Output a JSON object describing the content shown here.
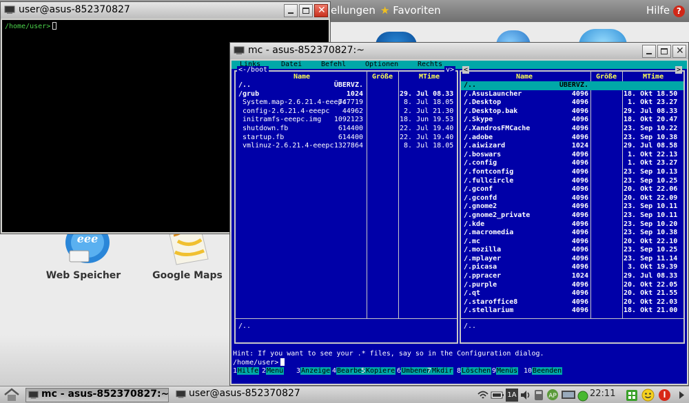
{
  "desktop": {
    "topbar": {
      "left_partial": "ellungen",
      "favorites": "Favoriten",
      "help": "Hilfe"
    },
    "launchers": [
      {
        "label": "Web Speicher"
      },
      {
        "label": "Google Maps"
      }
    ]
  },
  "terminal": {
    "title": "user@asus-852370827",
    "prompt": "/home/user>"
  },
  "mc": {
    "title": "mc - asus-852370827:~",
    "menubar": [
      "Links",
      "Datei",
      "Befehl",
      "Optionen",
      "Rechts"
    ],
    "left_panel": {
      "path": "<-/boot",
      "arrow": "v>",
      "headers": {
        "name": "Name",
        "size": "Größe",
        "mtime": "MTime"
      },
      "rows": [
        {
          "name": "/..",
          "size": "ÜBERVZ.",
          "mtime": "",
          "bold": true
        },
        {
          "name": "/grub",
          "size": "1024",
          "mtime": "29. Jul 08.33",
          "bold": true
        },
        {
          "name": " System.map-2.6.21.4-eeepc",
          "size": "747719",
          "mtime": " 8. Jul 18.05",
          "bold": false
        },
        {
          "name": " config-2.6.21.4-eeepc",
          "size": "44962",
          "mtime": " 2. Jul 21.30",
          "bold": false
        },
        {
          "name": " initramfs-eeepc.img",
          "size": "1092123",
          "mtime": "18. Jun 19.53",
          "bold": false
        },
        {
          "name": " shutdown.fb",
          "size": "614400",
          "mtime": "22. Jul 19.40",
          "bold": false
        },
        {
          "name": " startup.fb",
          "size": "614400",
          "mtime": "22. Jul 19.40",
          "bold": false
        },
        {
          "name": " vmlinuz-2.6.21.4-eeepc",
          "size": "1327864",
          "mtime": " 8. Jul 18.05",
          "bold": false
        }
      ],
      "status": "/.."
    },
    "right_panel": {
      "nav_left": "<",
      "nav_right": ">",
      "headers": {
        "name": "Name",
        "size": "Größe",
        "mtime": "MTime"
      },
      "rows": [
        {
          "name": "/..",
          "size": "ÜBERVZ.",
          "mtime": "",
          "selected": true
        },
        {
          "name": "/.AsusLauncher",
          "size": "4096",
          "mtime": "18. Okt 18.50"
        },
        {
          "name": "/.Desktop",
          "size": "4096",
          "mtime": " 1. Okt 23.27"
        },
        {
          "name": "/.Desktop.bak",
          "size": "4096",
          "mtime": "29. Jul 08.33"
        },
        {
          "name": "/.Skype",
          "size": "4096",
          "mtime": "18. Okt 20.47"
        },
        {
          "name": "/.XandrosFMCache",
          "size": "4096",
          "mtime": "23. Sep 10.22"
        },
        {
          "name": "/.adobe",
          "size": "4096",
          "mtime": "23. Sep 10.38"
        },
        {
          "name": "/.aiwizard",
          "size": "1024",
          "mtime": "29. Jul 08.58"
        },
        {
          "name": "/.boswars",
          "size": "4096",
          "mtime": " 1. Okt 22.13"
        },
        {
          "name": "/.config",
          "size": "4096",
          "mtime": " 1. Okt 23.27"
        },
        {
          "name": "/.fontconfig",
          "size": "4096",
          "mtime": "23. Sep 10.13"
        },
        {
          "name": "/.fullcircle",
          "size": "4096",
          "mtime": "23. Sep 10.25"
        },
        {
          "name": "/.gconf",
          "size": "4096",
          "mtime": "20. Okt 22.06"
        },
        {
          "name": "/.gconfd",
          "size": "4096",
          "mtime": "20. Okt 22.09"
        },
        {
          "name": "/.gnome2",
          "size": "4096",
          "mtime": "23. Sep 10.11"
        },
        {
          "name": "/.gnome2_private",
          "size": "4096",
          "mtime": "23. Sep 10.11"
        },
        {
          "name": "/.kde",
          "size": "4096",
          "mtime": "23. Sep 10.20"
        },
        {
          "name": "/.macromedia",
          "size": "4096",
          "mtime": "23. Sep 10.38"
        },
        {
          "name": "/.mc",
          "size": "4096",
          "mtime": "20. Okt 22.10"
        },
        {
          "name": "/.mozilla",
          "size": "4096",
          "mtime": "23. Sep 10.25"
        },
        {
          "name": "/.mplayer",
          "size": "4096",
          "mtime": "23. Sep 11.14"
        },
        {
          "name": "/.picasa",
          "size": "4096",
          "mtime": " 3. Okt 19.39"
        },
        {
          "name": "/.ppracer",
          "size": "1024",
          "mtime": "29. Jul 08.33"
        },
        {
          "name": "/.purple",
          "size": "4096",
          "mtime": "20. Okt 22.05"
        },
        {
          "name": "/.qt",
          "size": "4096",
          "mtime": "20. Okt 21.55"
        },
        {
          "name": "/.staroffice8",
          "size": "4096",
          "mtime": "20. Okt 22.03"
        },
        {
          "name": "/.stellarium",
          "size": "4096",
          "mtime": "18. Okt 21.00"
        }
      ],
      "status": "/.."
    },
    "hint": "Hint: If you want to see your .* files, say so in the Configuration dialog.",
    "prompt": "/home/user>",
    "fkeys": [
      {
        "num": "1",
        "label": "Hilfe"
      },
      {
        "num": "2",
        "label": "Menü"
      },
      {
        "num": "3",
        "label": "Anzeige"
      },
      {
        "num": "4",
        "label": "Bearbei"
      },
      {
        "num": "5",
        "label": "Kopiere"
      },
      {
        "num": "6",
        "label": "Umbenen"
      },
      {
        "num": "7",
        "label": "Mkdir"
      },
      {
        "num": "8",
        "label": "Löschen"
      },
      {
        "num": "9",
        "label": "Menüs"
      },
      {
        "num": "10",
        "label": "Beenden"
      }
    ]
  },
  "taskbar": {
    "tasks": [
      {
        "label": "mc - asus-852370827:~",
        "active": true
      },
      {
        "label": "user@asus-852370827",
        "active": false
      }
    ],
    "clock": "22:11",
    "badge_1a": "1A"
  },
  "colors": {
    "mc_blue": "#0000a8",
    "mc_cyan": "#00a8a8",
    "mc_yellow": "#ffff54",
    "terminal_green": "#4cd44c",
    "close_red": "#c8301e"
  }
}
